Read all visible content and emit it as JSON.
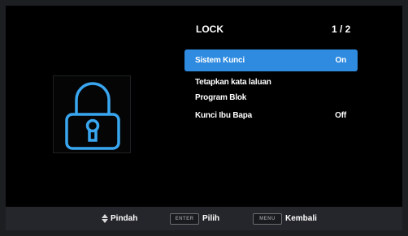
{
  "menu": {
    "title": "LOCK",
    "page": "1 / 2",
    "items": [
      {
        "label": "Sistem Kunci",
        "value": "On"
      },
      {
        "label": "Tetapkan kata laluan",
        "value": ""
      },
      {
        "label": "Program Blok",
        "value": ""
      },
      {
        "label": "Kunci Ibu Bapa",
        "value": "Off"
      }
    ]
  },
  "footer": {
    "move_label": "Pindah",
    "enter_key": "ENTER",
    "select_label": "Pilih",
    "menu_key": "MENU",
    "back_label": "Kembali"
  },
  "colors": {
    "accent": "#2f8be0",
    "lock_icon": "#39a6f0",
    "background": "#000000"
  },
  "icons": {
    "main": "padlock-icon",
    "nav": "up-down-arrows-icon"
  }
}
